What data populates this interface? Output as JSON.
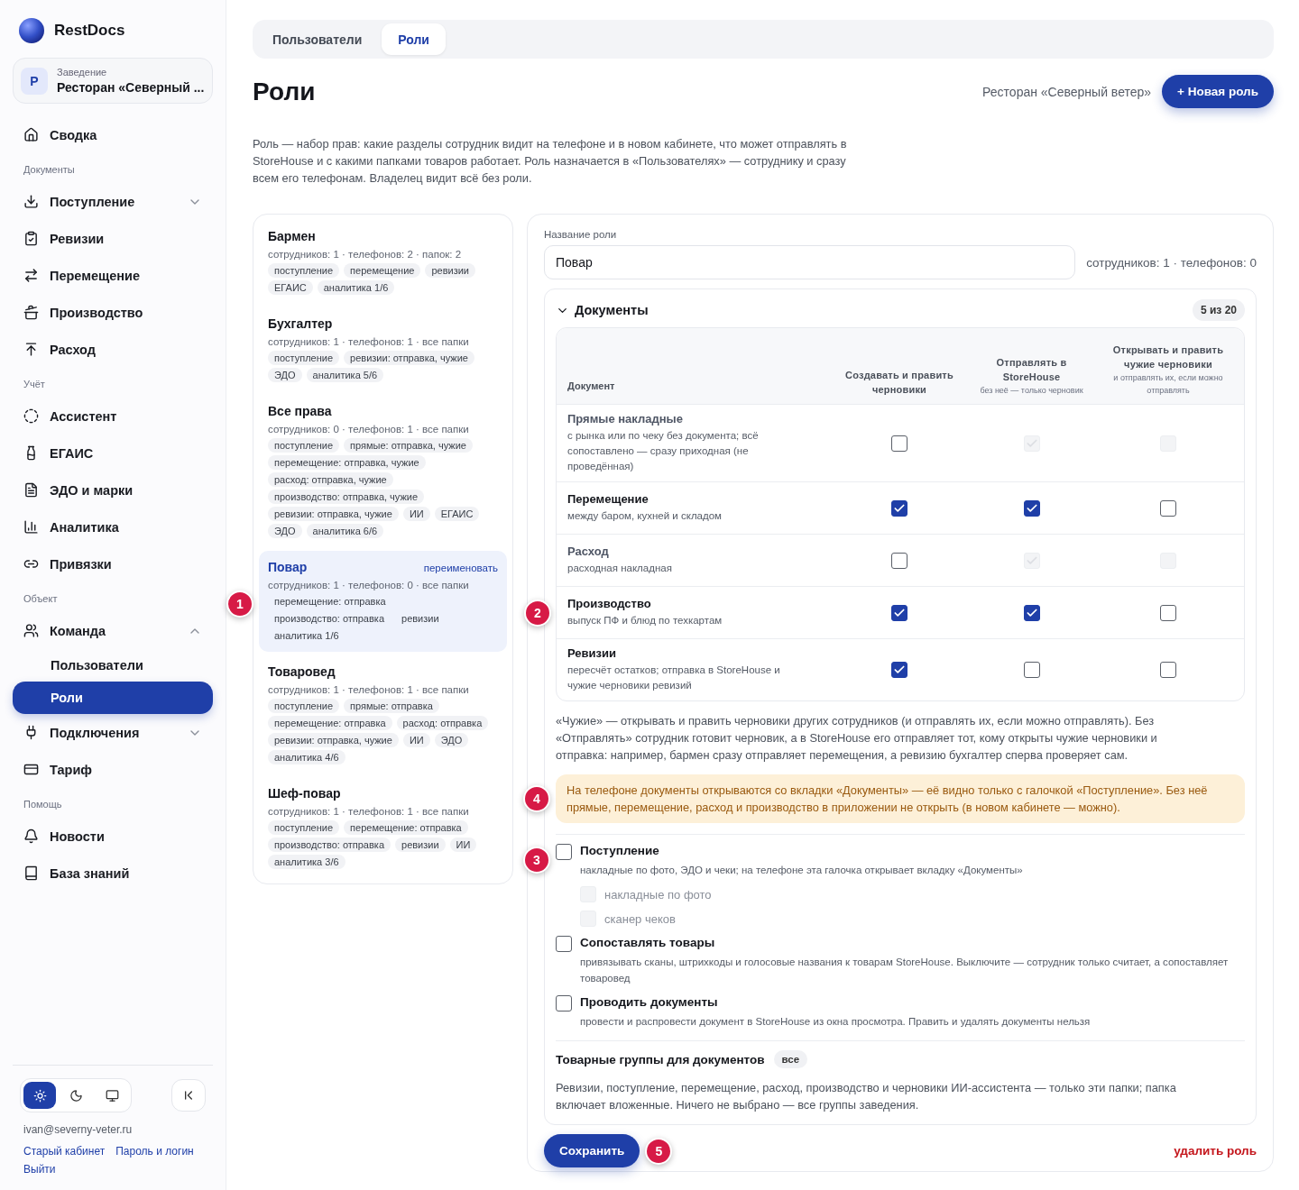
{
  "sidebar": {
    "brand": "RestDocs",
    "venue": {
      "badge": "Р",
      "label": "Заведение",
      "name": "Ресторан «Северный ..."
    },
    "nav": [
      {
        "kind": "item",
        "label": "Сводка",
        "selected": false
      },
      {
        "kind": "heading",
        "label": "Документы"
      },
      {
        "kind": "item",
        "label": "Поступление",
        "selected": false,
        "expanded": false
      },
      {
        "kind": "item",
        "label": "Ревизии",
        "selected": false
      },
      {
        "kind": "item",
        "label": "Перемещение",
        "selected": false
      },
      {
        "kind": "item",
        "label": "Производство",
        "selected": false
      },
      {
        "kind": "item",
        "label": "Расход",
        "selected": false
      },
      {
        "kind": "heading",
        "label": "Учёт"
      },
      {
        "kind": "item",
        "label": "Ассистент",
        "selected": false
      },
      {
        "kind": "item",
        "label": "ЕГАИС",
        "selected": false
      },
      {
        "kind": "item",
        "label": "ЭДО и марки",
        "selected": false
      },
      {
        "kind": "item",
        "label": "Аналитика",
        "selected": false
      },
      {
        "kind": "item",
        "label": "Привязки",
        "selected": false
      },
      {
        "kind": "heading",
        "label": "Объект"
      },
      {
        "kind": "item",
        "label": "Команда",
        "selected": false,
        "expanded": true,
        "children": [
          {
            "label": "Пользователи",
            "selected": false
          },
          {
            "label": "Роли",
            "selected": true
          }
        ]
      },
      {
        "kind": "item",
        "label": "Подключения",
        "selected": false,
        "expanded": false
      },
      {
        "kind": "item",
        "label": "Тариф",
        "selected": false
      },
      {
        "kind": "heading",
        "label": "Помощь"
      },
      {
        "kind": "item",
        "label": "Новости",
        "selected": false
      },
      {
        "kind": "item",
        "label": "База знаний",
        "selected": false
      }
    ],
    "theme_modes": [
      {
        "selected": true
      },
      {
        "selected": false
      },
      {
        "selected": false
      }
    ],
    "email": "ivan@severny-veter.ru",
    "links": [
      "Старый кабинет",
      "Пароль и логин"
    ],
    "logout": "Выйти"
  },
  "tabs": [
    {
      "label": "Пользователи",
      "selected": false
    },
    {
      "label": "Роли",
      "selected": true
    }
  ],
  "title": "Роли",
  "venue_name": "Ресторан «Северный ветер»",
  "new_button": "+ Новая роль",
  "description": "Роль — набор прав: какие разделы сотрудник видит на телефоне и в новом кабинете, что может отправлять в StoreHouse и с какими папками товаров работает. Роль назначается в «Пользователях» — сотруднику и сразу всем его телефонам. Владелец видит всё без роли.",
  "roles": [
    {
      "name": "Бармен",
      "meta": "сотрудников: 1 · телефонов: 2 · папок: 2",
      "selected": false,
      "tags": [
        "поступление",
        "перемещение",
        "ревизии",
        "ЕГАИС",
        "аналитика 1/6"
      ]
    },
    {
      "name": "Бухгалтер",
      "meta": "сотрудников: 1 · телефонов: 1 · все папки",
      "selected": false,
      "tags": [
        "поступление",
        "ревизии: отправка, чужие",
        "ЭДО",
        "аналитика 5/6"
      ]
    },
    {
      "name": "Все права",
      "meta": "сотрудников: 0 · телефонов: 1 · все папки",
      "selected": false,
      "tags": [
        "поступление",
        "прямые: отправка, чужие",
        "перемещение: отправка, чужие",
        "расход: отправка, чужие",
        "производство: отправка, чужие",
        "ревизии: отправка, чужие",
        "ИИ",
        "ЕГАИС",
        "ЭДО",
        "аналитика 6/6"
      ]
    },
    {
      "name": "Повар",
      "meta": "сотрудников: 1 · телефонов: 0 · все папки",
      "selected": true,
      "action": "переименовать",
      "callout": "1",
      "tags": [
        "перемещение: отправка",
        "производство: отправка",
        "ревизии",
        "аналитика 1/6"
      ]
    },
    {
      "name": "Товаровед",
      "meta": "сотрудников: 1 · телефонов: 1 · все папки",
      "selected": false,
      "tags": [
        "поступление",
        "прямые: отправка",
        "перемещение: отправка",
        "расход: отправка",
        "ревизии: отправка, чужие",
        "ИИ",
        "ЭДО",
        "аналитика 4/6"
      ]
    },
    {
      "name": "Шеф-повар",
      "meta": "сотрудников: 1 · телефонов: 1 · все папки",
      "selected": false,
      "tags": [
        "поступление",
        "перемещение: отправка",
        "производство: отправка",
        "ревизии",
        "ИИ",
        "аналитика 3/6"
      ]
    }
  ],
  "editor": {
    "name_label": "Название роли",
    "name_value": "Повар",
    "counts": "сотрудников: 1 · телефонов: 0",
    "documents": {
      "title": "Документы",
      "expanded": true,
      "badge": "5 из 20",
      "columns": [
        {
          "title": "Документ"
        },
        {
          "title": "Создавать и править черновики"
        },
        {
          "title": "Отправлять в StoreHouse",
          "hint": "без неё — только черновик"
        },
        {
          "title": "Открывать и править чужие черновики",
          "hint": "и отправлять их, если можно отправлять"
        }
      ],
      "rows": [
        {
          "title": "Прямые накладные",
          "desc": "с рынка или по чеку без документа; всё сопоставлено — сразу приходная (не проведённая)",
          "muted": true,
          "cells": [
            {
              "checked": false,
              "disabled": false
            },
            {
              "checked": true,
              "disabled": true
            },
            {
              "checked": false,
              "disabled": true
            }
          ]
        },
        {
          "title": "Перемещение",
          "desc": "между баром, кухней и складом",
          "muted": false,
          "cells": [
            {
              "checked": true,
              "disabled": false
            },
            {
              "checked": true,
              "disabled": false
            },
            {
              "checked": false,
              "disabled": false
            }
          ]
        },
        {
          "title": "Расход",
          "desc": "расходная накладная",
          "muted": true,
          "cells": [
            {
              "checked": false,
              "disabled": false
            },
            {
              "checked": true,
              "disabled": true
            },
            {
              "checked": false,
              "disabled": true
            }
          ]
        },
        {
          "title": "Производство",
          "desc": "выпуск ПФ и блюд по техкартам",
          "muted": false,
          "callout": "2",
          "cells": [
            {
              "checked": true,
              "disabled": false
            },
            {
              "checked": true,
              "disabled": false
            },
            {
              "checked": false,
              "disabled": false
            }
          ]
        },
        {
          "title": "Ревизии",
          "desc": "пересчёт остатков; отправка в StoreHouse и чужие черновики ревизий",
          "muted": false,
          "cells": [
            {
              "checked": true,
              "disabled": false
            },
            {
              "checked": false,
              "disabled": false
            },
            {
              "checked": false,
              "disabled": false
            }
          ]
        }
      ]
    },
    "note": "«Чужие» — открывать и править черновики других сотрудников (и отправлять их, если можно отправлять). Без «Отправлять» сотрудник готовит черновик, а в StoreHouse его отправляет тот, кому открыты чужие черновики и отправка: например, бармен сразу отправляет перемещения, а ревизию бухгалтер сперва проверяет сам.",
    "notice": {
      "text": "На телефоне документы открываются со вкладки «Документы» — её видно только с галочкой «Поступление». Без неё прямые, перемещение, расход и производство в приложении не открыть (в новом кабинете — можно).",
      "callout": "4"
    },
    "options": [
      {
        "title": "Поступление",
        "desc": "накладные по фото, ЭДО и чеки; на телефоне эта галочка открывает вкладку «Документы»",
        "checked": false,
        "callout": "3",
        "suboptions": [
          {
            "label": "накладные по фото",
            "checked": false,
            "disabled": true
          },
          {
            "label": "сканер чеков",
            "checked": false,
            "disabled": true
          }
        ]
      },
      {
        "title": "Сопоставлять товары",
        "desc": "привязывать сканы, штрихкоды и голосовые названия к товарам StoreHouse. Выключите — сотрудник только считает, а сопоставляет товаровед",
        "checked": false
      },
      {
        "title": "Проводить документы",
        "desc": "провести и распровести документ в StoreHouse из окна просмотра. Править и удалять документы нельзя",
        "checked": false
      }
    ],
    "groups": {
      "title": "Товарные группы для документов",
      "badge": "все",
      "text": "Ревизии, поступление, перемещение, расход, производство и черновики ИИ-ассистента — только эти папки; папка включает вложенные. Ничего не выбрано — все группы заведения."
    },
    "save": "Сохранить",
    "save_callout": "5",
    "delete": "удалить роль"
  }
}
